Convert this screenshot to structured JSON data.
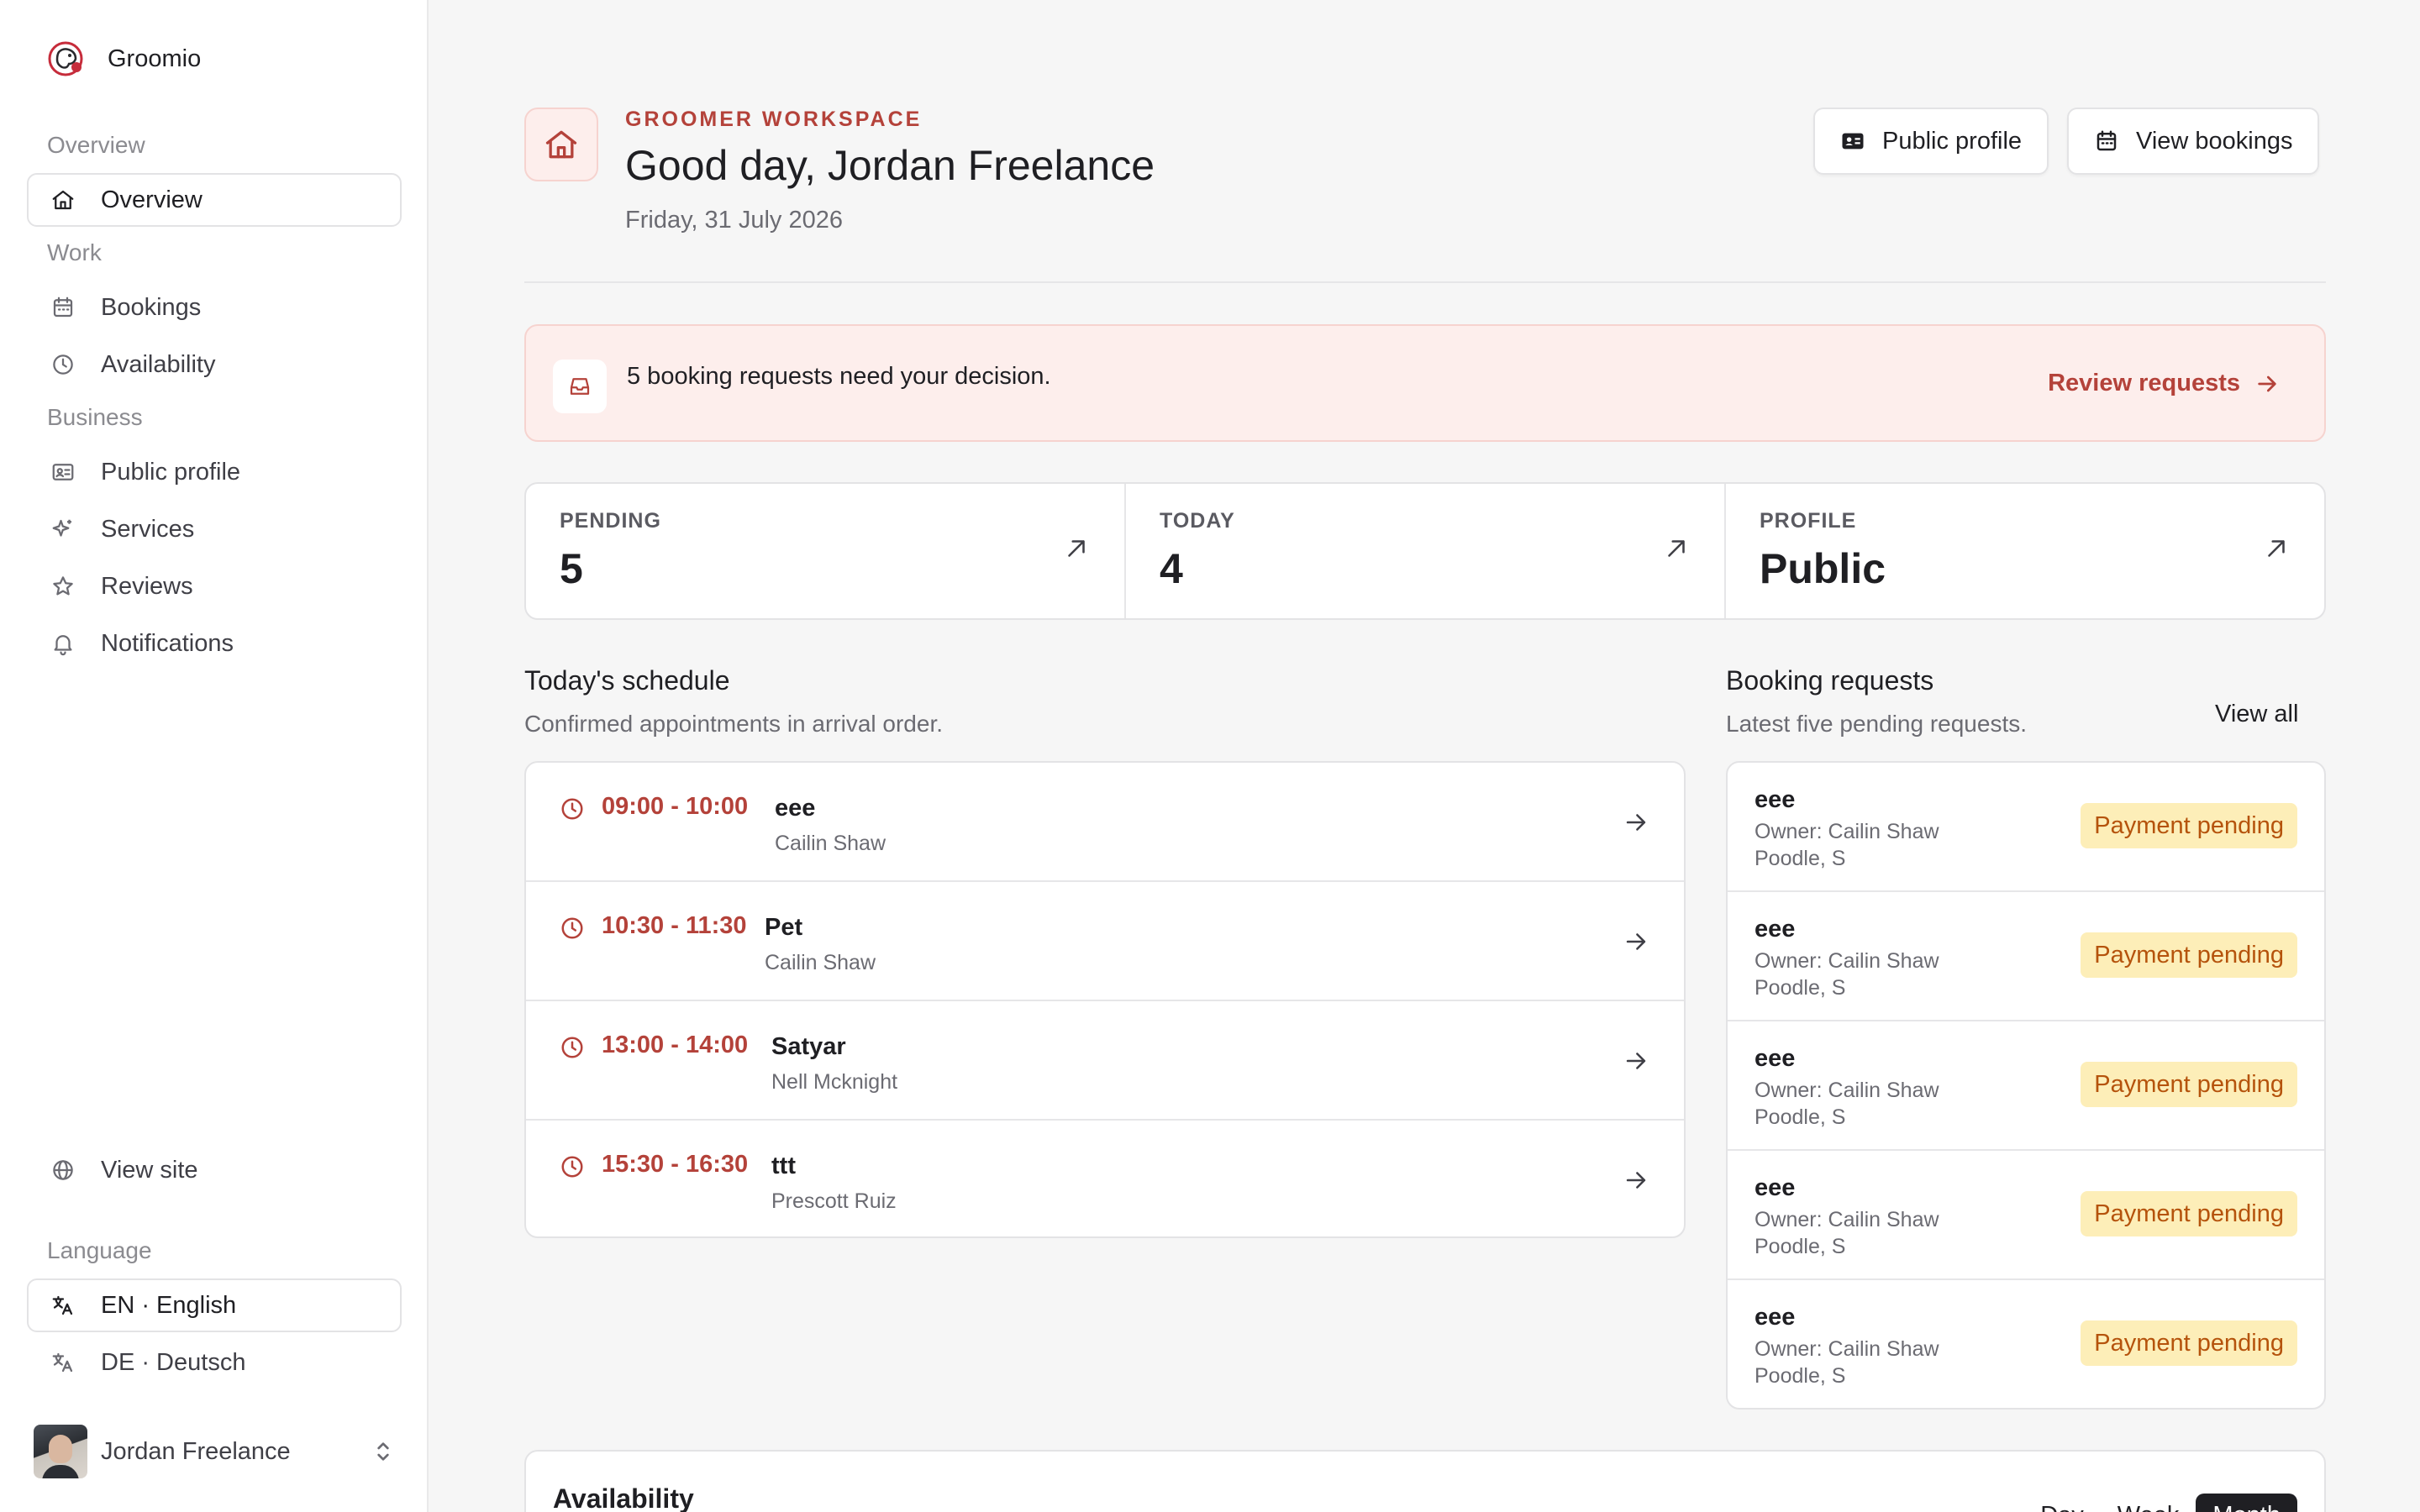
{
  "brand": {
    "name": "Groomio"
  },
  "sidebar": {
    "groups": {
      "overview": "Overview",
      "work": "Work",
      "business": "Business",
      "language": "Language"
    },
    "items": {
      "overview": "Overview",
      "bookings": "Bookings",
      "availability": "Availability",
      "public_profile": "Public profile",
      "services": "Services",
      "reviews": "Reviews",
      "notifications": "Notifications",
      "view_site": "View site"
    },
    "languages": {
      "en": "EN · English",
      "de": "DE · Deutsch",
      "selected": "EN · English"
    },
    "user": {
      "name": "Jordan Freelance"
    }
  },
  "header": {
    "eyebrow": "GROOMER WORKSPACE",
    "greeting": "Good day, Jordan Freelance",
    "date": "Friday, 31 July 2026",
    "public_profile_label": "Public profile",
    "view_bookings_label": "View bookings"
  },
  "alert": {
    "text": "5 booking requests need your decision.",
    "link": "Review requests"
  },
  "stats": [
    {
      "label": "PENDING",
      "value": "5"
    },
    {
      "label": "TODAY",
      "value": "4"
    },
    {
      "label": "PROFILE",
      "value": "Public"
    }
  ],
  "schedule": {
    "title": "Today's schedule",
    "subtitle": "Confirmed appointments in arrival order.",
    "rows": [
      {
        "time": "09:00 - 10:00",
        "name": "eee",
        "owner": "Cailin Shaw"
      },
      {
        "time": "10:30 - 11:30",
        "name": "Pet",
        "owner": "Cailin Shaw"
      },
      {
        "time": "13:00 - 14:00",
        "name": "Satyar",
        "owner": "Nell Mcknight"
      },
      {
        "time": "15:30 - 16:30",
        "name": "ttt",
        "owner": "Prescott Ruiz"
      }
    ]
  },
  "requests": {
    "title": "Booking requests",
    "subtitle": "Latest five pending requests.",
    "view_all": "View all",
    "rows": [
      {
        "name": "eee",
        "owner": "Owner: Cailin Shaw",
        "pet": "Poodle, S",
        "status": "Payment pending"
      },
      {
        "name": "eee",
        "owner": "Owner: Cailin Shaw",
        "pet": "Poodle, S",
        "status": "Payment pending"
      },
      {
        "name": "eee",
        "owner": "Owner: Cailin Shaw",
        "pet": "Poodle, S",
        "status": "Payment pending"
      },
      {
        "name": "eee",
        "owner": "Owner: Cailin Shaw",
        "pet": "Poodle, S",
        "status": "Payment pending"
      },
      {
        "name": "eee",
        "owner": "Owner: Cailin Shaw",
        "pet": "Poodle, S",
        "status": "Payment pending"
      }
    ]
  },
  "availability": {
    "title": "Availability",
    "views": {
      "day": "Day",
      "week": "Week",
      "month": "Month"
    }
  },
  "colors": {
    "accent": "#b4423a",
    "accent_bg": "#fdeeec",
    "badge_bg": "#fdeeb8",
    "badge_text": "#b5530c"
  }
}
